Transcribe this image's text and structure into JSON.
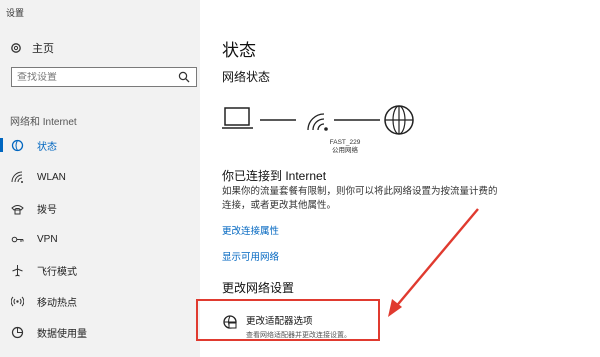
{
  "window": {
    "title": "设置"
  },
  "sidebar": {
    "home_label": "主页",
    "search_placeholder": "查找设置",
    "section_label": "网络和 Internet",
    "items": [
      {
        "label": "状态",
        "icon": "globe-status-icon",
        "active": true
      },
      {
        "label": "WLAN",
        "icon": "wifi-icon"
      },
      {
        "label": "拨号",
        "icon": "phone-dial-icon"
      },
      {
        "label": "VPN",
        "icon": "vpn-icon"
      },
      {
        "label": "飞行模式",
        "icon": "airplane-icon"
      },
      {
        "label": "移动热点",
        "icon": "hotspot-icon"
      },
      {
        "label": "数据使用量",
        "icon": "data-usage-icon"
      }
    ]
  },
  "main": {
    "title": "状态",
    "network_status_title": "网络状态",
    "network_name": "FAST_229",
    "network_type": "公用网络",
    "connected_title": "你已连接到 Internet",
    "connected_desc": "如果你的流量套餐有限制，则你可以将此网络设置为按流量计费的连接，或者更改其他属性。",
    "link_change_properties": "更改连接属性",
    "link_show_networks": "显示可用网络",
    "change_settings_title": "更改网络设置",
    "adapter_option_title": "更改适配器选项",
    "adapter_option_desc": "查看网络适配器并更改连接设置。"
  },
  "colors": {
    "accent": "#0066c0",
    "highlight_red": "#e03a2f",
    "sidebar_bg": "#f2f2f2"
  }
}
